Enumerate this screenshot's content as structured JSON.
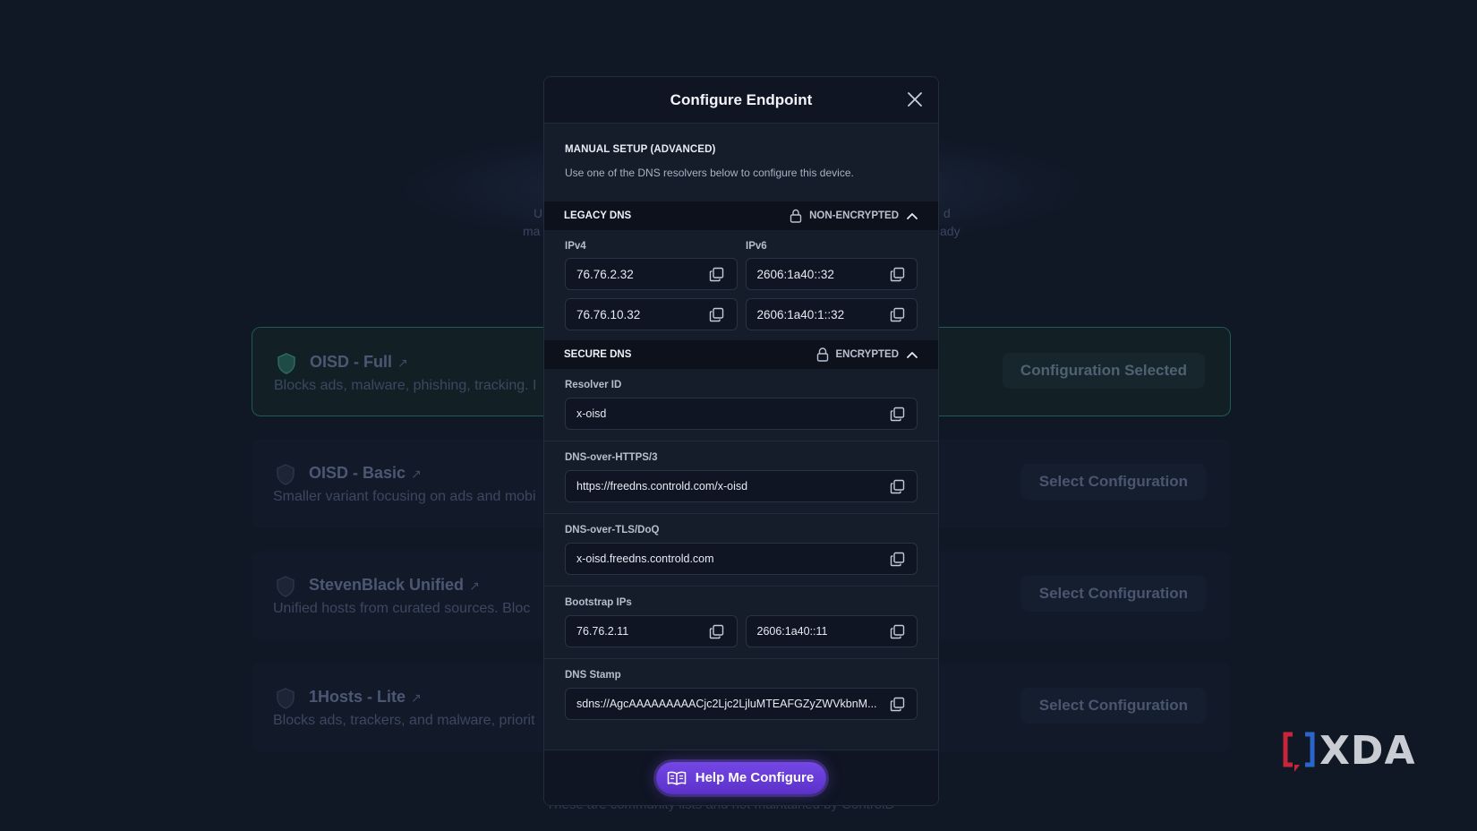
{
  "background": {
    "hint_left": "U",
    "hint_left2": "ma",
    "hint_right": "d",
    "hint_right2": "ady",
    "configs": [
      {
        "title": "OISD - Full",
        "desc": "Blocks ads, malware, phishing, tracking. I",
        "button": "Configuration Selected",
        "selected": true
      },
      {
        "title": "OISD - Basic",
        "desc": "Smaller variant focusing on ads and mobi",
        "button": "Select Configuration",
        "selected": false
      },
      {
        "title": "StevenBlack Unified",
        "desc": "Unified hosts from curated sources. Bloc",
        "button": "Select Configuration",
        "selected": false
      },
      {
        "title": "1Hosts - Lite",
        "desc": "Blocks ads, trackers, and malware, priorit",
        "button": "Select Configuration",
        "selected": false
      }
    ],
    "footer_text": "These are community lists and not maintained by ControlD"
  },
  "modal": {
    "title": "Configure Endpoint",
    "intro_heading": "MANUAL SETUP (ADVANCED)",
    "intro_text": "Use one of the DNS resolvers below to configure this device.",
    "legacy": {
      "label": "LEGACY DNS",
      "status": "NON-ENCRYPTED",
      "ipv4_label": "IPv4",
      "ipv6_label": "IPv6",
      "ipv4": [
        "76.76.2.32",
        "76.76.10.32"
      ],
      "ipv6": [
        "2606:1a40::32",
        "2606:1a40:1::32"
      ]
    },
    "secure": {
      "label": "SECURE DNS",
      "status": "ENCRYPTED",
      "resolver_label": "Resolver ID",
      "resolver": "x-oisd",
      "doh_label": "DNS-over-HTTPS/3",
      "doh": "https://freedns.controld.com/x-oisd",
      "dot_label": "DNS-over-TLS/DoQ",
      "dot": "x-oisd.freedns.controld.com",
      "bootstrap_label": "Bootstrap IPs",
      "bootstrap": [
        "76.76.2.11",
        "2606:1a40::11"
      ],
      "stamp_label": "DNS Stamp",
      "stamp": "sdns://AgcAAAAAAAAACjc2Ljc2LjluMTEAFGZyZWVkbnM..."
    },
    "help_button": "Help Me Configure"
  },
  "watermark": {
    "text": "XDA"
  },
  "colors": {
    "accent": "#6a3fdc",
    "teal": "#1f5a55",
    "modal_bg": "#151c2a"
  }
}
